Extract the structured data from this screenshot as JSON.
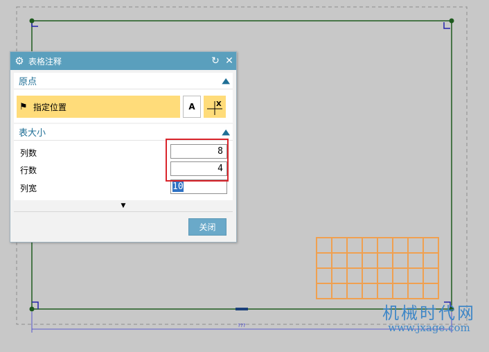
{
  "dialog": {
    "title": "表格注释",
    "title_buttons": {
      "reset_icon": "reset-icon",
      "close_icon": "close-icon"
    },
    "origin_section": {
      "heading": "原点",
      "specify_location_label": "指定位置",
      "font_button_text": "A",
      "point_button_text": "X"
    },
    "size_section": {
      "heading": "表大小",
      "fields": [
        {
          "label": "列数",
          "value": "8"
        },
        {
          "label": "行数",
          "value": "4"
        },
        {
          "label": "列宽",
          "value": "10"
        }
      ]
    },
    "close_label": "关闭"
  },
  "drawing": {
    "dimension_text": "???",
    "table_preview": {
      "columns": 8,
      "rows": 4
    },
    "colors": {
      "border": "#1e5a1e",
      "table": "#f0a050",
      "dimension": "#3a3acc",
      "corner": "#2222aa",
      "dialog_accent": "#5a9fbd",
      "highlight": "#ffdc7a",
      "callout": "#d9232a"
    }
  },
  "watermark": {
    "line1": "机械时代网",
    "line2": "www.jxage.com"
  }
}
